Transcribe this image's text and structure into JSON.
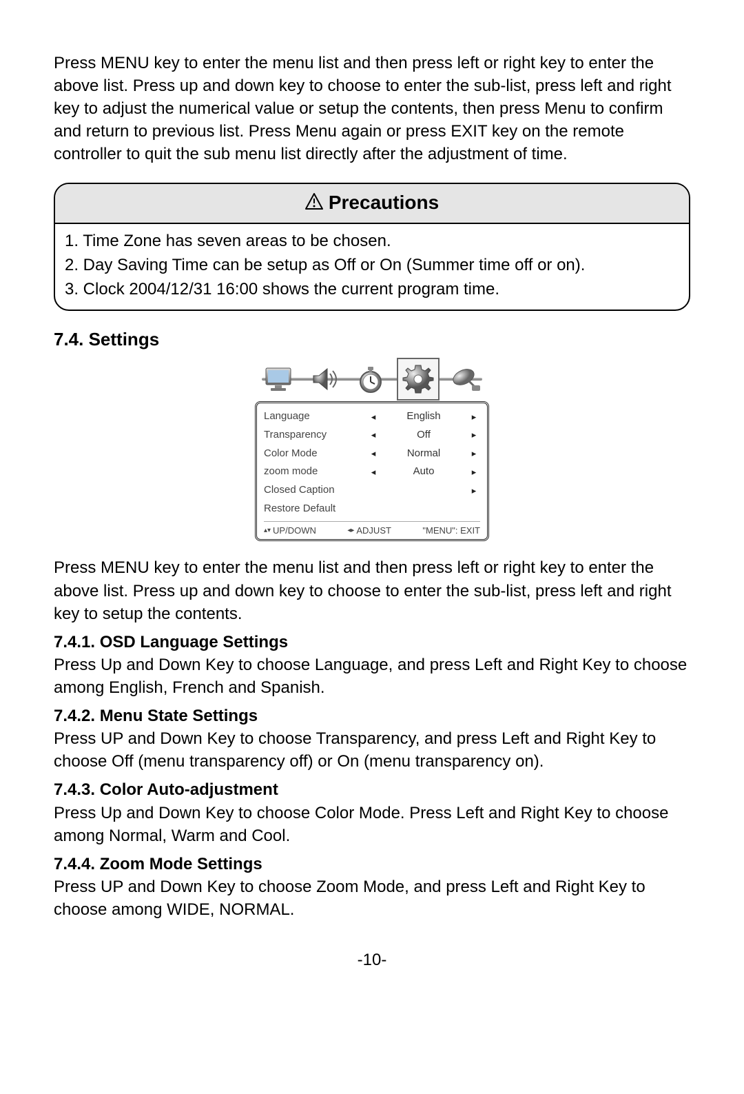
{
  "intro": "Press MENU key to enter the menu list and then press left or right key to enter the above list. Press up and down key to choose to enter the sub-list, press left and right key to adjust the numerical value or setup the contents, then press Menu to confirm and return to previous list. Press Menu again or press EXIT key on the remote controller to quit the sub menu list directly after the adjustment of time.",
  "precautions": {
    "title": "Precautions",
    "items": [
      "1. Time Zone has seven areas to be chosen.",
      "2. Day Saving Time can be setup as Off or On (Summer time off or on).",
      "3. Clock 2004/12/31 16:00 shows the current program time."
    ]
  },
  "settings_heading": "7.4. Settings",
  "menu": {
    "rows": [
      {
        "label": "Language",
        "left": "◂",
        "value": "English",
        "right": "▸"
      },
      {
        "label": "Transparency",
        "left": "◂",
        "value": "Off",
        "right": "▸"
      },
      {
        "label": "Color  Mode",
        "left": "◂",
        "value": "Normal",
        "right": "▸"
      },
      {
        "label": "zoom mode",
        "left": "◂",
        "value": "Auto",
        "right": "▸"
      },
      {
        "label": "Closed  Caption",
        "left": "",
        "value": "",
        "right": "▸"
      },
      {
        "label": "Restore Default",
        "left": "",
        "value": "",
        "right": ""
      }
    ],
    "footer": {
      "updown": "UP/DOWN",
      "adjust": "ADJUST",
      "exit": "\"MENU\": EXIT"
    }
  },
  "settings_intro": "Press MENU key to enter the menu list and then press left or right key to enter the above list. Press up and down key to choose to enter the sub-list, press left and right key to setup the contents.",
  "sections": {
    "s1": {
      "h": "7.4.1. OSD Language Settings",
      "p": "Press Up and Down Key to choose Language, and press Left and Right Key to choose among English, French and Spanish."
    },
    "s2": {
      "h": "7.4.2. Menu State Settings",
      "p": "Press UP and Down Key to choose Transparency, and press Left and Right Key to choose Off (menu transparency off) or On (menu transparency on)."
    },
    "s3": {
      "h": "7.4.3. Color Auto-adjustment",
      "p": "Press Up and Down Key to choose Color Mode. Press Left and Right Key to choose among Normal, Warm and Cool."
    },
    "s4": {
      "h": "7.4.4. Zoom Mode Settings",
      "p": "Press UP and Down Key to choose Zoom Mode, and press Left and Right Key to choose among WIDE, NORMAL."
    }
  },
  "page_number": "-10-"
}
